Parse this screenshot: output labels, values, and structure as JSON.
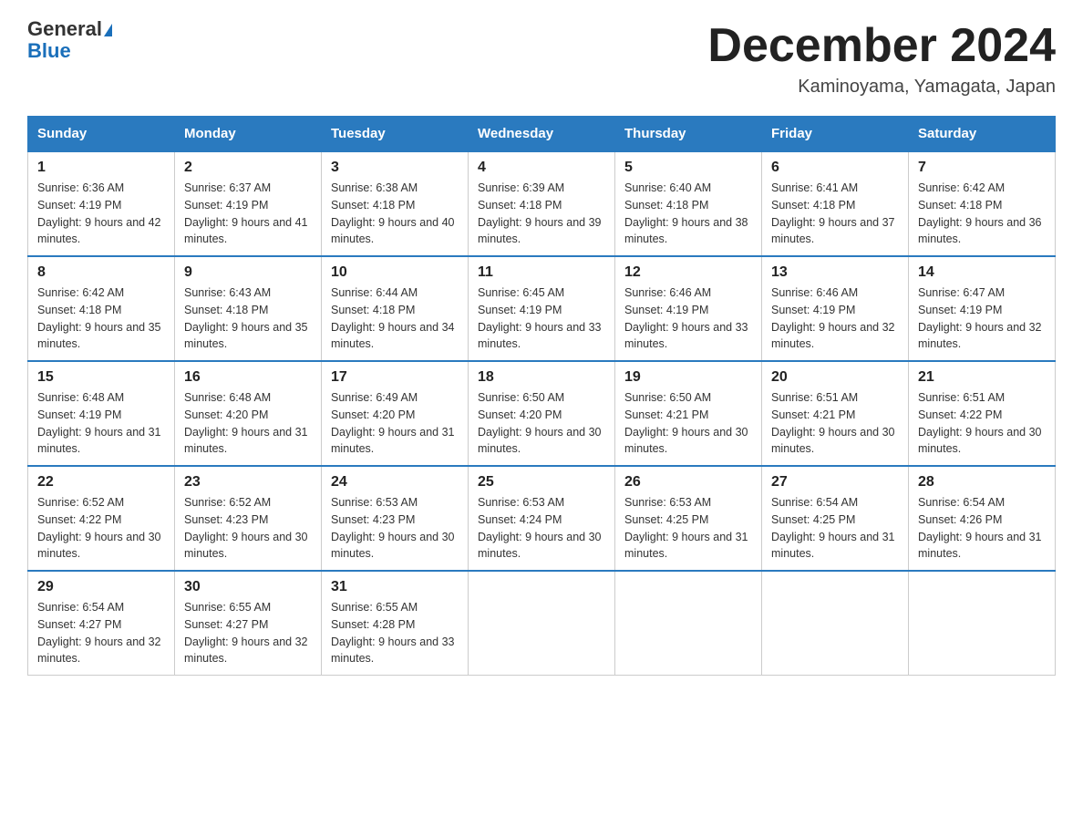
{
  "header": {
    "logo_general": "General",
    "logo_blue": "Blue",
    "month_title": "December 2024",
    "location": "Kaminoyama, Yamagata, Japan"
  },
  "days_of_week": [
    "Sunday",
    "Monday",
    "Tuesday",
    "Wednesday",
    "Thursday",
    "Friday",
    "Saturday"
  ],
  "weeks": [
    [
      {
        "day": "1",
        "sunrise": "Sunrise: 6:36 AM",
        "sunset": "Sunset: 4:19 PM",
        "daylight": "Daylight: 9 hours and 42 minutes."
      },
      {
        "day": "2",
        "sunrise": "Sunrise: 6:37 AM",
        "sunset": "Sunset: 4:19 PM",
        "daylight": "Daylight: 9 hours and 41 minutes."
      },
      {
        "day": "3",
        "sunrise": "Sunrise: 6:38 AM",
        "sunset": "Sunset: 4:18 PM",
        "daylight": "Daylight: 9 hours and 40 minutes."
      },
      {
        "day": "4",
        "sunrise": "Sunrise: 6:39 AM",
        "sunset": "Sunset: 4:18 PM",
        "daylight": "Daylight: 9 hours and 39 minutes."
      },
      {
        "day": "5",
        "sunrise": "Sunrise: 6:40 AM",
        "sunset": "Sunset: 4:18 PM",
        "daylight": "Daylight: 9 hours and 38 minutes."
      },
      {
        "day": "6",
        "sunrise": "Sunrise: 6:41 AM",
        "sunset": "Sunset: 4:18 PM",
        "daylight": "Daylight: 9 hours and 37 minutes."
      },
      {
        "day": "7",
        "sunrise": "Sunrise: 6:42 AM",
        "sunset": "Sunset: 4:18 PM",
        "daylight": "Daylight: 9 hours and 36 minutes."
      }
    ],
    [
      {
        "day": "8",
        "sunrise": "Sunrise: 6:42 AM",
        "sunset": "Sunset: 4:18 PM",
        "daylight": "Daylight: 9 hours and 35 minutes."
      },
      {
        "day": "9",
        "sunrise": "Sunrise: 6:43 AM",
        "sunset": "Sunset: 4:18 PM",
        "daylight": "Daylight: 9 hours and 35 minutes."
      },
      {
        "day": "10",
        "sunrise": "Sunrise: 6:44 AM",
        "sunset": "Sunset: 4:18 PM",
        "daylight": "Daylight: 9 hours and 34 minutes."
      },
      {
        "day": "11",
        "sunrise": "Sunrise: 6:45 AM",
        "sunset": "Sunset: 4:19 PM",
        "daylight": "Daylight: 9 hours and 33 minutes."
      },
      {
        "day": "12",
        "sunrise": "Sunrise: 6:46 AM",
        "sunset": "Sunset: 4:19 PM",
        "daylight": "Daylight: 9 hours and 33 minutes."
      },
      {
        "day": "13",
        "sunrise": "Sunrise: 6:46 AM",
        "sunset": "Sunset: 4:19 PM",
        "daylight": "Daylight: 9 hours and 32 minutes."
      },
      {
        "day": "14",
        "sunrise": "Sunrise: 6:47 AM",
        "sunset": "Sunset: 4:19 PM",
        "daylight": "Daylight: 9 hours and 32 minutes."
      }
    ],
    [
      {
        "day": "15",
        "sunrise": "Sunrise: 6:48 AM",
        "sunset": "Sunset: 4:19 PM",
        "daylight": "Daylight: 9 hours and 31 minutes."
      },
      {
        "day": "16",
        "sunrise": "Sunrise: 6:48 AM",
        "sunset": "Sunset: 4:20 PM",
        "daylight": "Daylight: 9 hours and 31 minutes."
      },
      {
        "day": "17",
        "sunrise": "Sunrise: 6:49 AM",
        "sunset": "Sunset: 4:20 PM",
        "daylight": "Daylight: 9 hours and 31 minutes."
      },
      {
        "day": "18",
        "sunrise": "Sunrise: 6:50 AM",
        "sunset": "Sunset: 4:20 PM",
        "daylight": "Daylight: 9 hours and 30 minutes."
      },
      {
        "day": "19",
        "sunrise": "Sunrise: 6:50 AM",
        "sunset": "Sunset: 4:21 PM",
        "daylight": "Daylight: 9 hours and 30 minutes."
      },
      {
        "day": "20",
        "sunrise": "Sunrise: 6:51 AM",
        "sunset": "Sunset: 4:21 PM",
        "daylight": "Daylight: 9 hours and 30 minutes."
      },
      {
        "day": "21",
        "sunrise": "Sunrise: 6:51 AM",
        "sunset": "Sunset: 4:22 PM",
        "daylight": "Daylight: 9 hours and 30 minutes."
      }
    ],
    [
      {
        "day": "22",
        "sunrise": "Sunrise: 6:52 AM",
        "sunset": "Sunset: 4:22 PM",
        "daylight": "Daylight: 9 hours and 30 minutes."
      },
      {
        "day": "23",
        "sunrise": "Sunrise: 6:52 AM",
        "sunset": "Sunset: 4:23 PM",
        "daylight": "Daylight: 9 hours and 30 minutes."
      },
      {
        "day": "24",
        "sunrise": "Sunrise: 6:53 AM",
        "sunset": "Sunset: 4:23 PM",
        "daylight": "Daylight: 9 hours and 30 minutes."
      },
      {
        "day": "25",
        "sunrise": "Sunrise: 6:53 AM",
        "sunset": "Sunset: 4:24 PM",
        "daylight": "Daylight: 9 hours and 30 minutes."
      },
      {
        "day": "26",
        "sunrise": "Sunrise: 6:53 AM",
        "sunset": "Sunset: 4:25 PM",
        "daylight": "Daylight: 9 hours and 31 minutes."
      },
      {
        "day": "27",
        "sunrise": "Sunrise: 6:54 AM",
        "sunset": "Sunset: 4:25 PM",
        "daylight": "Daylight: 9 hours and 31 minutes."
      },
      {
        "day": "28",
        "sunrise": "Sunrise: 6:54 AM",
        "sunset": "Sunset: 4:26 PM",
        "daylight": "Daylight: 9 hours and 31 minutes."
      }
    ],
    [
      {
        "day": "29",
        "sunrise": "Sunrise: 6:54 AM",
        "sunset": "Sunset: 4:27 PM",
        "daylight": "Daylight: 9 hours and 32 minutes."
      },
      {
        "day": "30",
        "sunrise": "Sunrise: 6:55 AM",
        "sunset": "Sunset: 4:27 PM",
        "daylight": "Daylight: 9 hours and 32 minutes."
      },
      {
        "day": "31",
        "sunrise": "Sunrise: 6:55 AM",
        "sunset": "Sunset: 4:28 PM",
        "daylight": "Daylight: 9 hours and 33 minutes."
      },
      null,
      null,
      null,
      null
    ]
  ]
}
